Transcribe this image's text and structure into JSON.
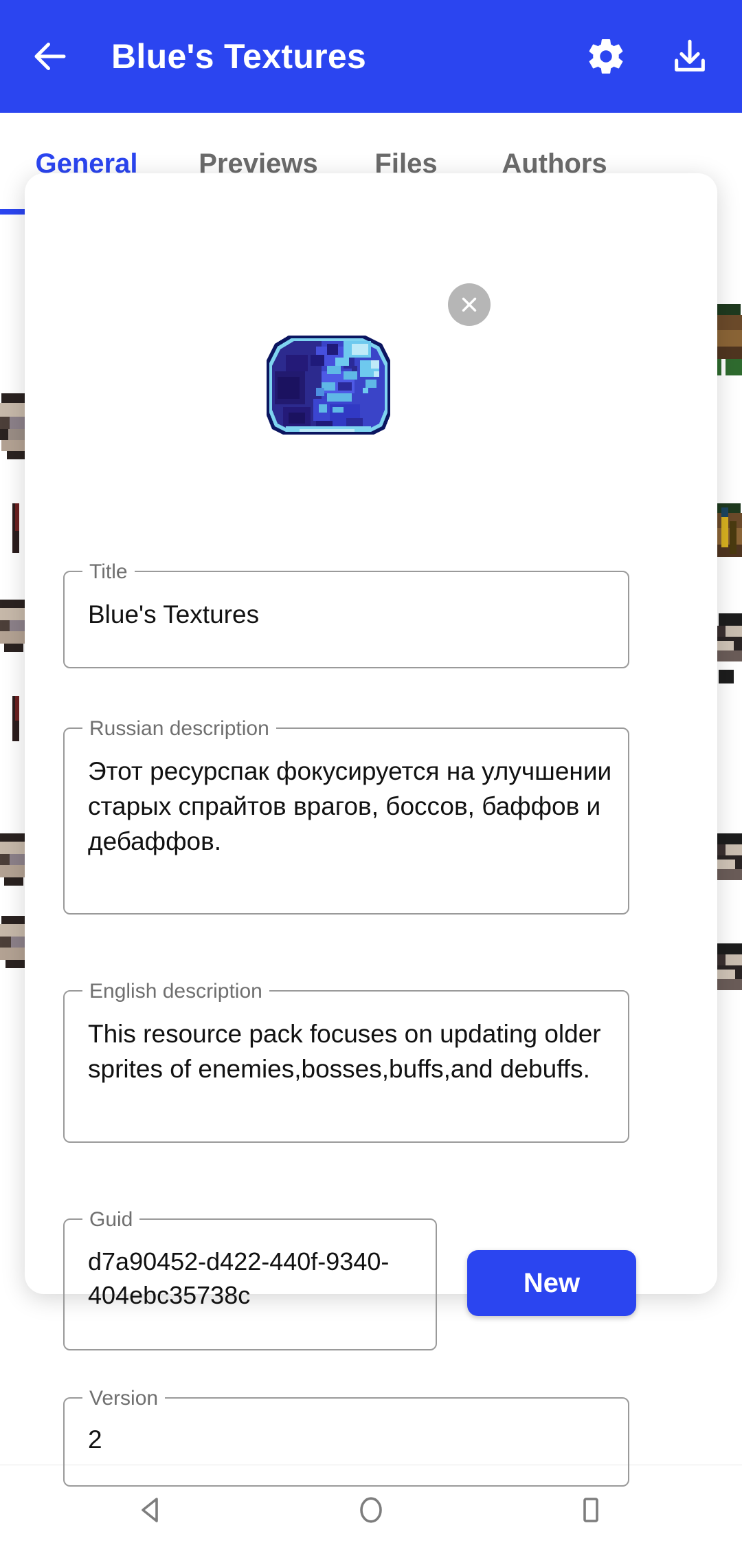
{
  "appbar": {
    "back_icon": "arrow-left-icon",
    "title": "Blue's Textures",
    "settings_icon": "gear-icon",
    "download_icon": "download-icon"
  },
  "tabs": [
    {
      "label": "General",
      "active": true
    },
    {
      "label": "Previews",
      "active": false
    },
    {
      "label": "Files",
      "active": false
    },
    {
      "label": "Authors",
      "active": false
    }
  ],
  "dialog": {
    "close_icon": "close-icon",
    "icon_art": "blue-slime-sprite",
    "fields": {
      "title": {
        "legend": "Title",
        "value": "Blue's Textures"
      },
      "russian": {
        "legend": "Russian description",
        "value": "Этот ресурспак фокусируется на улучшении старых спрайтов врагов, боссов, баффов и дебаффов."
      },
      "english": {
        "legend": "English description",
        "value": "This resource pack focuses on updating older sprites of enemies,bosses,buffs,and debuffs."
      },
      "guid": {
        "legend": "Guid",
        "value": "d7a90452-d422-440f-9340-404ebc35738c"
      },
      "version": {
        "legend": "Version",
        "value": "2"
      }
    },
    "new_button": "New"
  },
  "navbar": {
    "back": "nav-back-icon",
    "home": "nav-home-icon",
    "recents": "nav-recents-icon"
  },
  "colors": {
    "accent": "#2B45F0",
    "tab_inactive": "#6b6b6b",
    "field_border": "#9a9a9a",
    "legend_text": "#6f6f6f",
    "close_bg": "#b6b6b6"
  }
}
